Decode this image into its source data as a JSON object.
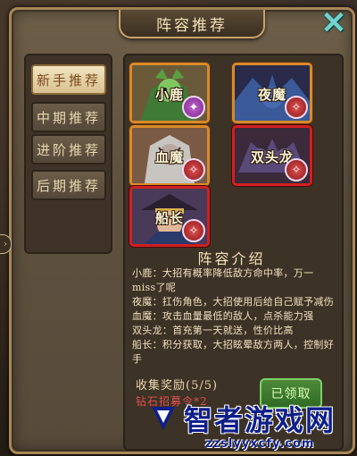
{
  "dialog": {
    "title": "阵容推荐",
    "close_icon": "close-x-icon"
  },
  "tabs": [
    {
      "label": "新手推荐",
      "active": true
    },
    {
      "label": "中期推荐",
      "active": false
    },
    {
      "label": "进阶推荐",
      "active": false
    },
    {
      "label": "后期推荐",
      "active": false
    }
  ],
  "heroes": [
    {
      "name": "小鹿",
      "frame_color": "#d98a2a",
      "badge": "purple-class-icon"
    },
    {
      "name": "夜魔",
      "frame_color": "#d98a2a",
      "badge": "red-class-icon"
    },
    {
      "name": "血魔",
      "frame_color": "#d98a2a",
      "badge": "red-class-icon"
    },
    {
      "name": "双头龙",
      "frame_color": "#d12020",
      "badge": "red-class-icon"
    },
    {
      "name": "船长",
      "frame_color": "#d12020",
      "badge": "red-class-icon"
    }
  ],
  "intro": {
    "title": "阵容介绍",
    "lines": [
      "小鹿：大招有概率降低敌方命中率，万一miss了呢",
      "夜魔：扛伤角色，大招使用后给自己赋予减伤",
      "血魔：攻击血量最低的敌人，点杀能力强",
      "双头龙：首充第一天就送，性价比高",
      "船长：积分获取，大招眩晕敌方两人，控制好手"
    ]
  },
  "reward": {
    "label": "收集奖励(5/5)",
    "item": "钻石招募令*2",
    "claim_label": "已领取"
  },
  "watermark": {
    "text": "智者游戏网",
    "url": "zzslyyxcfy.com"
  }
}
